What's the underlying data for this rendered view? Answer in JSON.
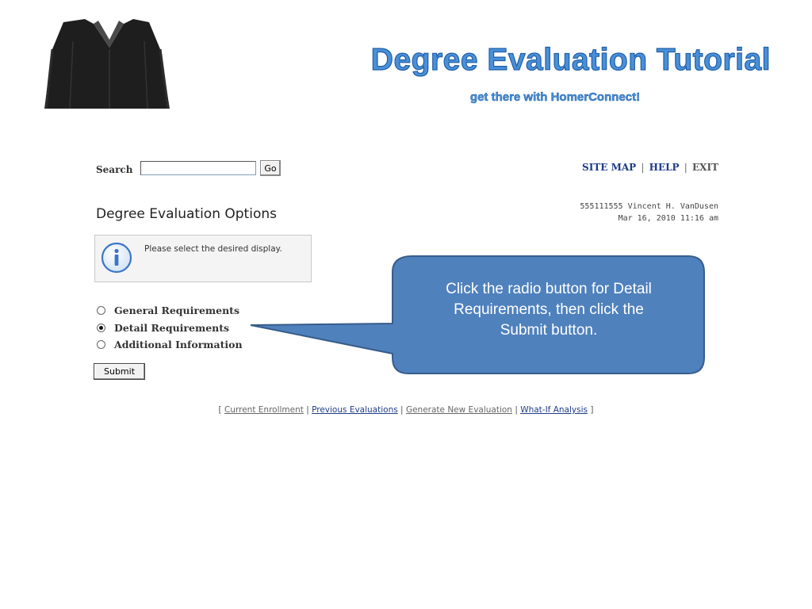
{
  "slide": {
    "title": "Degree Evaluation Tutorial",
    "subtitle": "get there with HomerConnect!"
  },
  "search": {
    "label": "Search",
    "value": "",
    "go_label": "Go"
  },
  "top_links": {
    "site_map": "SITE MAP",
    "help": "HELP",
    "exit": "EXIT",
    "separator": "|"
  },
  "user": {
    "id_name": "555111555 Vincent H. VanDusen",
    "datetime": "Mar 16, 2010 11:16 am"
  },
  "page": {
    "title": "Degree Evaluation Options",
    "info_text": "Please select the desired display."
  },
  "options": [
    {
      "label": "General Requirements",
      "checked": false
    },
    {
      "label": "Detail Requirements",
      "checked": true
    },
    {
      "label": "Additional Information",
      "checked": false
    }
  ],
  "submit_label": "Submit",
  "bottom_links": {
    "open": "[",
    "close": "]",
    "sep": "|",
    "items": [
      "Current Enrollment",
      "Previous Evaluations",
      "Generate New Evaluation",
      "What-If Analysis"
    ]
  },
  "callout": {
    "line1": "Click the radio button for Detail",
    "line2": "Requirements, then click the",
    "line3": "Submit button."
  },
  "colors": {
    "title_blue": "#4a90d9",
    "link_blue": "#1f3c88",
    "callout_fill": "#4f81bd",
    "callout_border": "#385d8a"
  }
}
